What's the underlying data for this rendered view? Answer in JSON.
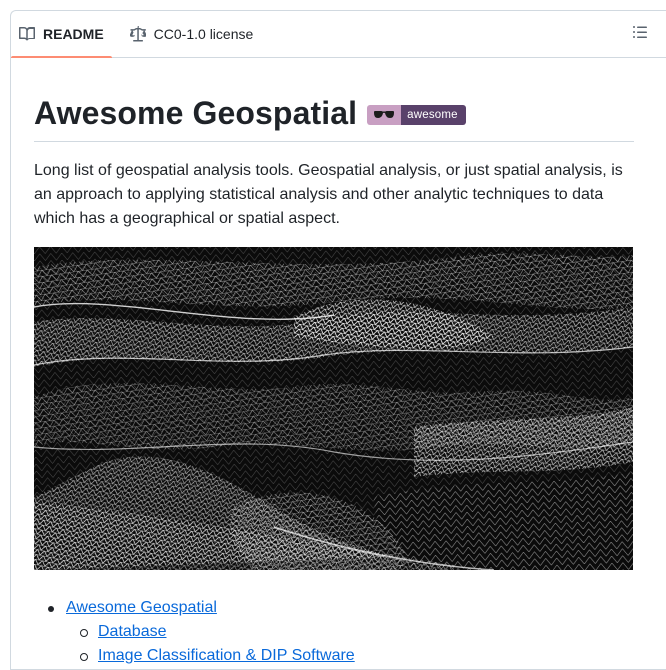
{
  "tabs": {
    "readme_label": "README",
    "license_label": "CC0-1.0 license"
  },
  "readme": {
    "title": "Awesome Geospatial",
    "badge_text": "awesome",
    "intro": "Long list of geospatial analysis tools. Geospatial analysis, or just spatial analysis, is an approach to applying statistical analysis and other analytic techniques to data which has a geographical or spatial aspect.",
    "hero_image": "geospatial-wireframe-terrain"
  },
  "toc": {
    "top": "Awesome Geospatial",
    "items": [
      "Database",
      "Image Classification & DIP Software"
    ]
  },
  "colors": {
    "accent_underline": "#fd8c73",
    "link": "#0969da",
    "badge_left": "#c89fc2",
    "badge_right": "#59416a"
  }
}
